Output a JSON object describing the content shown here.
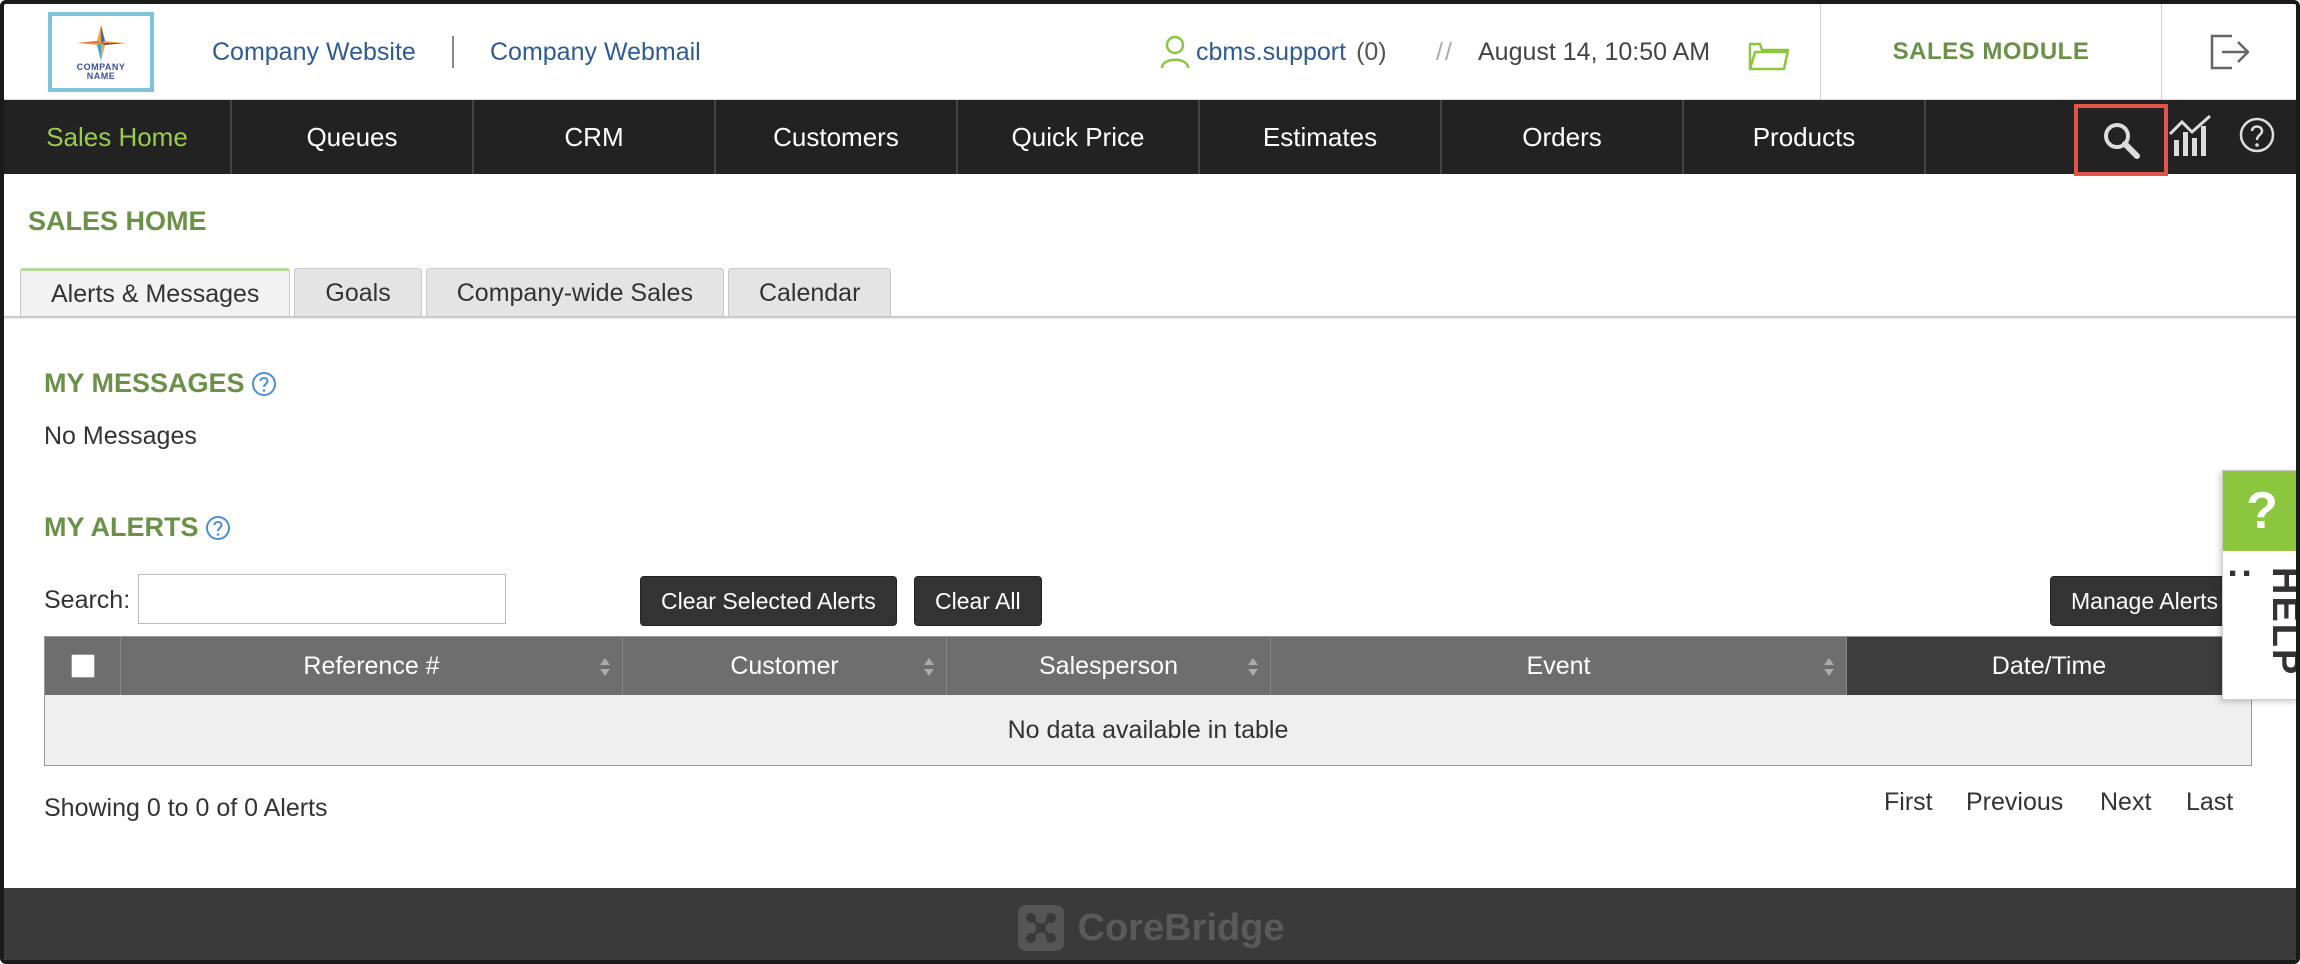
{
  "header": {
    "logo_text_1": "COMPANY",
    "logo_text_2": "NAME",
    "company_website": "Company Website",
    "company_webmail": "Company Webmail",
    "user_name": "cbms.support",
    "user_count": "(0)",
    "separator": "//",
    "datetime": "August 14, 10:50 AM",
    "module_label": "SALES MODULE"
  },
  "nav": {
    "items": [
      "Sales Home",
      "Queues",
      "CRM",
      "Customers",
      "Quick Price",
      "Estimates",
      "Orders",
      "Products"
    ]
  },
  "page": {
    "title": "SALES HOME",
    "tabs": [
      "Alerts & Messages",
      "Goals",
      "Company-wide Sales",
      "Calendar"
    ]
  },
  "messages": {
    "title": "MY MESSAGES",
    "empty": "No Messages"
  },
  "alerts": {
    "title": "MY ALERTS",
    "search_label": "Search:",
    "search_value": "",
    "clear_selected": "Clear Selected Alerts",
    "clear_all": "Clear All",
    "manage": "Manage Alerts",
    "columns": [
      "Reference #",
      "Customer",
      "Salesperson",
      "Event",
      "Date/Time"
    ],
    "empty": "No data available in table",
    "showing": "Showing 0 to 0 of 0 Alerts",
    "pager": {
      "first": "First",
      "previous": "Previous",
      "next": "Next",
      "last": "Last"
    }
  },
  "help_tab": {
    "symbol": "?",
    "label": "HELP :"
  },
  "footer": {
    "brand": "CoreBridge"
  },
  "colors": {
    "accent_green": "#6b9148",
    "nav_bg": "#222222",
    "nav_active": "#9ccb4e",
    "link_blue": "#2e5a97",
    "highlight_red": "#e0554a",
    "help_green": "#8cc63f"
  },
  "icons": [
    "user-icon",
    "folder-icon",
    "logout-icon",
    "search-icon",
    "chart-icon",
    "help-circle-icon",
    "question-icon",
    "sort-icon"
  ]
}
